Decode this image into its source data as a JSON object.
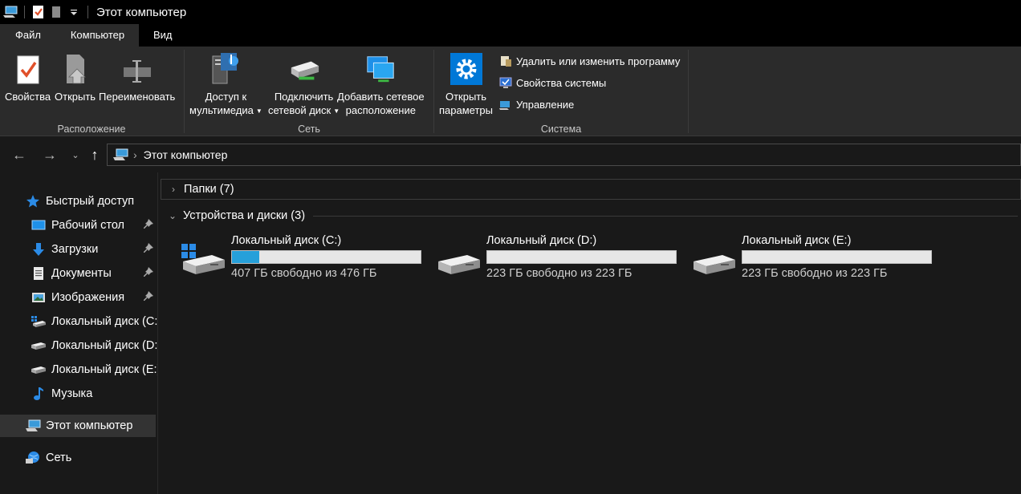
{
  "window": {
    "title": "Этот компьютер"
  },
  "tabs": {
    "file": "Файл",
    "computer": "Компьютер",
    "view": "Вид"
  },
  "ribbon": {
    "location": {
      "label": "Расположение",
      "properties": "Свойства",
      "open": "Открыть",
      "rename": "Переименовать"
    },
    "network": {
      "label": "Сеть",
      "media_line1": "Доступ к",
      "media_line2": "мультимедиа",
      "map_line1": "Подключить",
      "map_line2": "сетевой диск",
      "add_line1": "Добавить сетевое",
      "add_line2": "расположение"
    },
    "system": {
      "label": "Система",
      "settings_line1": "Открыть",
      "settings_line2": "параметры",
      "uninstall": "Удалить или изменить программу",
      "sysprops": "Свойства системы",
      "manage": "Управление"
    }
  },
  "address": {
    "crumb": "Этот компьютер"
  },
  "navpane": {
    "quick_access": "Быстрый доступ",
    "desktop": "Рабочий стол",
    "downloads": "Загрузки",
    "documents": "Документы",
    "pictures": "Изображения",
    "disk_c": "Локальный диск (C:)",
    "disk_d": "Локальный диск (D:)",
    "disk_e": "Локальный диск (E:)",
    "music": "Музыка",
    "this_pc": "Этот компьютер",
    "network": "Сеть"
  },
  "content": {
    "folders_header": "Папки (7)",
    "devices_header": "Устройства и диски (3)",
    "drives": [
      {
        "name": "Локальный диск (C:)",
        "free": "407 ГБ свободно из 476 ГБ",
        "used_fraction": 0.145
      },
      {
        "name": "Локальный диск (D:)",
        "free": "223 ГБ свободно из 223 ГБ",
        "used_fraction": 0.0
      },
      {
        "name": "Локальный диск (E:)",
        "free": "223 ГБ свободно из 223 ГБ",
        "used_fraction": 0.0
      }
    ]
  },
  "colors": {
    "accent": "#26a0da",
    "background": "#191919",
    "ribbon": "#2b2b2b",
    "selected": "#333333"
  }
}
